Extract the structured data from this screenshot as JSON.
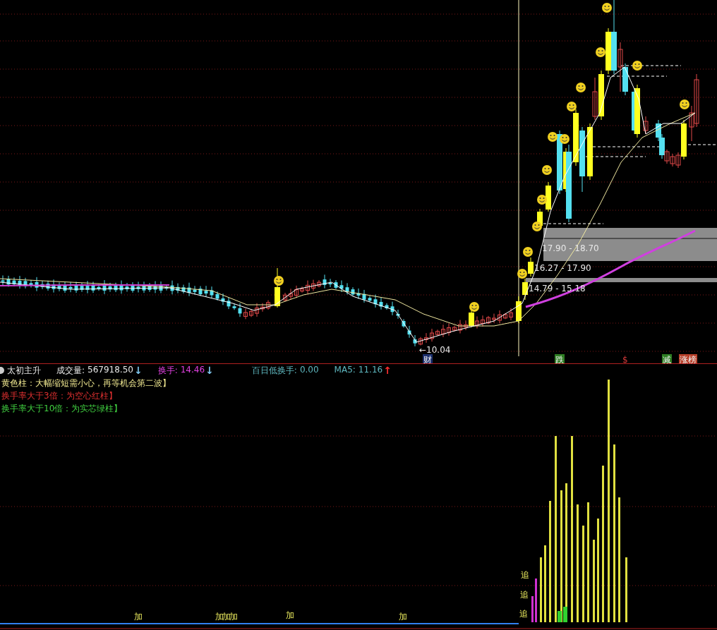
{
  "price_panel": {
    "low_label": "←10.04",
    "zones": [
      {
        "label": "17.90 - 18.70"
      },
      {
        "label": "16.27 - 17.90"
      },
      {
        "label": "14.79 - 15.18"
      }
    ],
    "event_markers": [
      {
        "text": "财",
        "kind": "boxed",
        "color": "#1c2f6e"
      },
      {
        "text": "跌",
        "kind": "boxed",
        "color": "#2e7d22"
      },
      {
        "text": "$",
        "kind": "plain",
        "color": "#d83a3a"
      },
      {
        "text": "减",
        "kind": "boxed",
        "color": "#2e7d22"
      },
      {
        "text": "涨榜",
        "kind": "boxed",
        "color": "#b8402a"
      }
    ]
  },
  "indicator": {
    "name": "太初主升",
    "readouts": [
      {
        "label": "成交量:",
        "value": "567918.50",
        "arrow": "↓",
        "rising": false,
        "color": "#e8e8e8"
      },
      {
        "label": "换手:",
        "value": "14.46",
        "arrow": "↓",
        "rising": false,
        "color": "#e040e0"
      },
      {
        "label": "百日低换手:",
        "value": "0.00",
        "color": "#5fb8c0"
      },
      {
        "label": "MA5:",
        "value": "11.16",
        "arrow": "↑",
        "rising": true,
        "color": "#5fb8c0"
      }
    ],
    "legend": [
      {
        "text": "黄色柱：大幅缩短需小心，再等机会第二波】",
        "color": "#f0e890"
      },
      {
        "text": "换手率大于3倍：为空心红柱】",
        "color": "#e03030"
      },
      {
        "text": "换手率大于10倍：为实芯绿柱】",
        "color": "#40d040"
      }
    ],
    "signal_labels": [
      {
        "text": "加"
      },
      {
        "text": "加"
      },
      {
        "text": "加"
      },
      {
        "text": "加"
      },
      {
        "text": "加"
      },
      {
        "text": "加"
      },
      {
        "text": "追"
      },
      {
        "text": "追"
      },
      {
        "text": "追"
      }
    ]
  }
}
